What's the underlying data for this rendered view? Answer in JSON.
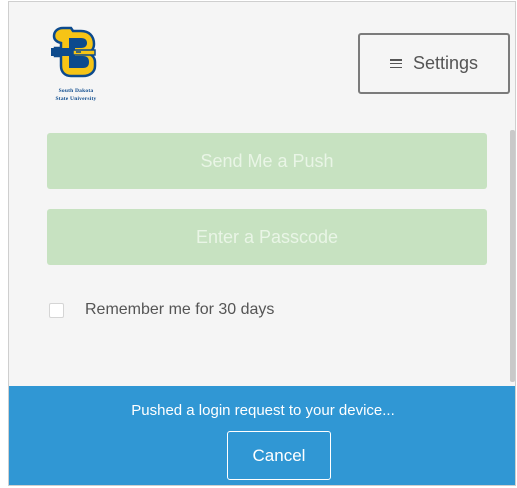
{
  "logo": {
    "line1": "South Dakota",
    "line2": "State University"
  },
  "settings": {
    "label": "Settings",
    "icon": "hamburger-menu-icon"
  },
  "actions": {
    "push_label": "Send Me a Push",
    "passcode_label": "Enter a Passcode"
  },
  "remember": {
    "label": "Remember me for 30 days",
    "checked": false
  },
  "status": {
    "message": "Pushed a login request to your device...",
    "cancel_label": "Cancel"
  },
  "colors": {
    "panel_bg": "#f5f5f5",
    "disabled_button": "#c7e2c1",
    "status_bar": "#3097d4",
    "brand_blue": "#0c4a8d",
    "brand_yellow": "#f6c416"
  }
}
